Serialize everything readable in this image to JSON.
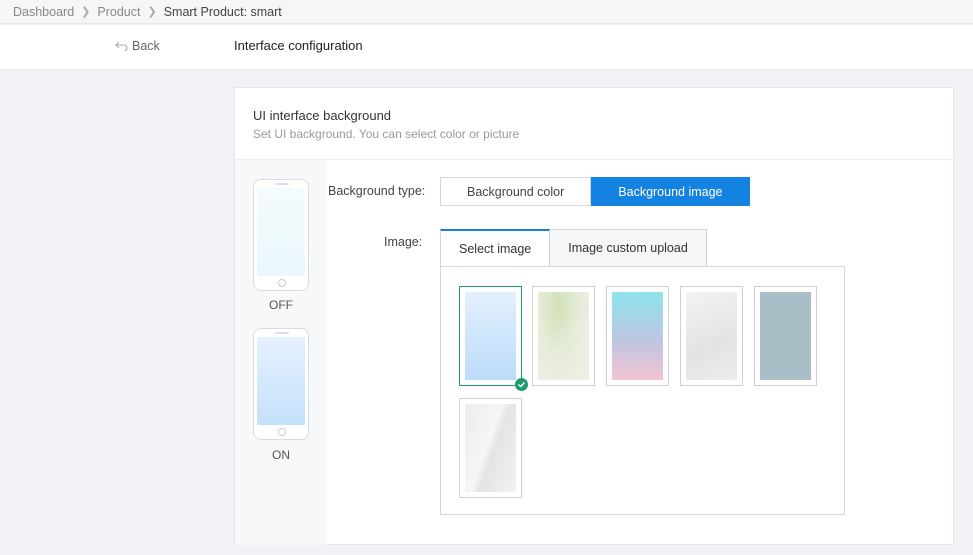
{
  "breadcrumb": {
    "items": [
      "Dashboard",
      "Product",
      "Smart Product: smart"
    ]
  },
  "header": {
    "back_label": "Back",
    "title": "Interface configuration"
  },
  "card": {
    "title": "UI interface background",
    "subtitle": "Set UI background. You can select color or picture"
  },
  "preview": {
    "off_label": "OFF",
    "on_label": "ON"
  },
  "form": {
    "bg_type_label": "Background type:",
    "bg_type_options": [
      "Background color",
      "Background image"
    ],
    "bg_type_selected": "Background image",
    "image_label": "Image:",
    "tabs": [
      "Select image",
      "Image custom upload"
    ],
    "active_tab": "Select image"
  },
  "gallery": {
    "selected_index": 0,
    "thumbnails": [
      "light-blue-gradient",
      "green-leaves-blur",
      "cyan-pink-gradient",
      "light-gray-texture",
      "slate-blue-gray",
      "white-glass-streak"
    ]
  },
  "colors": {
    "accent": "#1482e0",
    "selected_check": "#1f9a6e"
  }
}
